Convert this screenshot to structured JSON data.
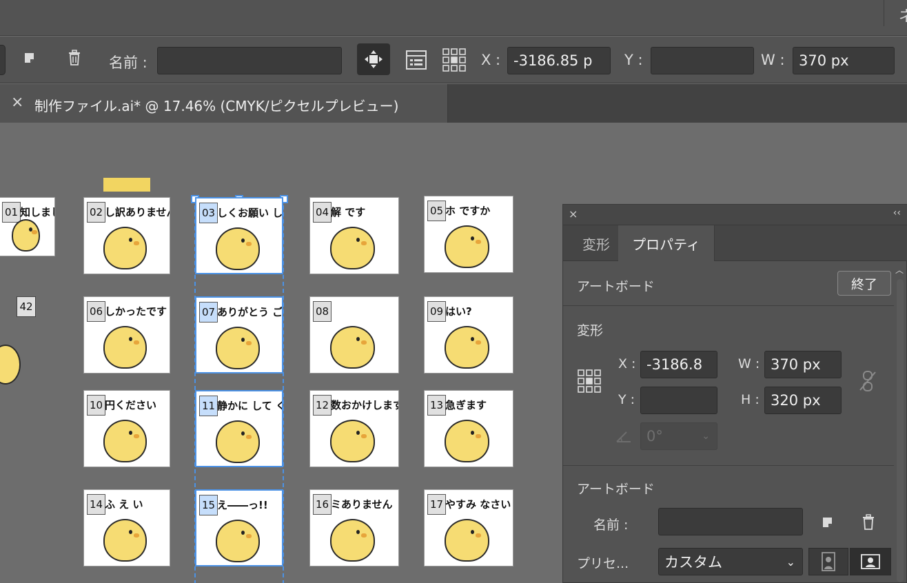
{
  "topbar": {
    "corner_char": "ネ"
  },
  "control_bar": {
    "name_label": "名前 :",
    "name_value": "",
    "x_label": "X :",
    "x_value": "-3186.85 p",
    "y_label": "Y :",
    "y_value": "",
    "w_label": "W :",
    "w_value": "370 px",
    "icons": [
      "new-artboard-icon",
      "delete-icon",
      "move-artwork-icon",
      "artboard-options-icon",
      "reference-point-icon"
    ]
  },
  "document_tab": {
    "close": "×",
    "title": "制作ファイル.ai* @ 17.46% (CMYK/ピクセルプレビュー)"
  },
  "artboards": [
    {
      "num": "01",
      "caption": "知しました",
      "selected": false
    },
    {
      "num": "02",
      "caption": "し訳ありません",
      "selected": false
    },
    {
      "num": "03",
      "caption": "しくお願い します",
      "selected": true
    },
    {
      "num": "04",
      "caption": "解 です",
      "selected": false
    },
    {
      "num": "05",
      "caption": "ホ ですか",
      "selected": false
    },
    {
      "num": "06",
      "caption": "しかったです",
      "selected": false
    },
    {
      "num": "07",
      "caption": "ありがとう ございます",
      "selected": true
    },
    {
      "num": "08",
      "caption": "",
      "selected": false
    },
    {
      "num": "09",
      "caption": "はい?",
      "selected": false
    },
    {
      "num": "10",
      "caption": "円ください",
      "selected": false
    },
    {
      "num": "11",
      "caption": "静かに して ください",
      "selected": true
    },
    {
      "num": "12",
      "caption": "数おかけします",
      "selected": false
    },
    {
      "num": "13",
      "caption": "急ぎます",
      "selected": false
    },
    {
      "num": "14",
      "caption": "ふ え い",
      "selected": false
    },
    {
      "num": "15",
      "caption": "え――っ!!",
      "selected": true
    },
    {
      "num": "16",
      "caption": "ミありません",
      "selected": false
    },
    {
      "num": "17",
      "caption": "やすみ なさい",
      "selected": false
    }
  ],
  "loose_tag": "42",
  "properties_panel": {
    "close": "×",
    "collapse": "‹‹",
    "tabs": [
      "変形",
      "プロパティ"
    ],
    "active_tab": "プロパティ",
    "artboard_heading": "アートボード",
    "done_button": "終了",
    "transform_heading": "変形",
    "x_label": "X :",
    "x_value": "-3186.8",
    "y_label": "Y :",
    "y_value": "",
    "w_label": "W :",
    "w_value": "370 px",
    "h_label": "H :",
    "h_value": "320 px",
    "angle_value": "0°",
    "artboard_section_heading": "アートボード",
    "name_label": "名前 :",
    "name_value": "",
    "preset_label": "プリセ...",
    "preset_value": "カスタム"
  }
}
